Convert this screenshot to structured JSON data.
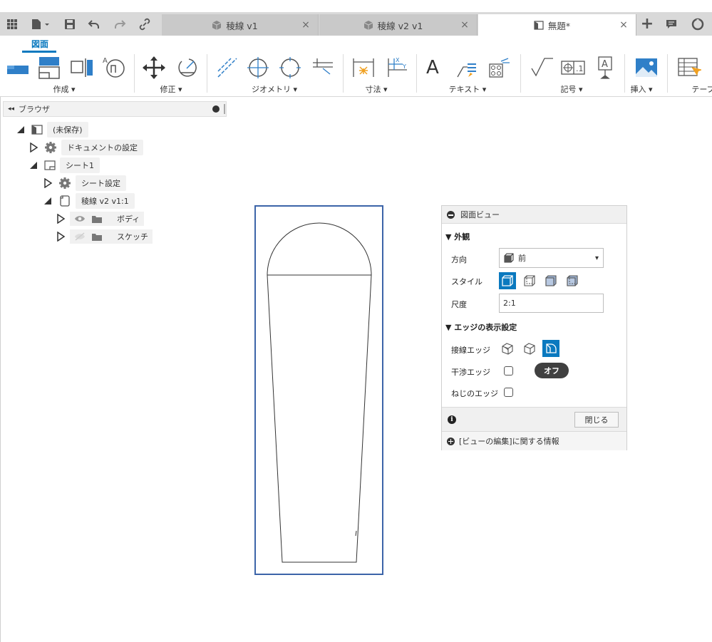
{
  "tabs": [
    {
      "label": "稜線 v1",
      "active": false
    },
    {
      "label": "稜線 v2 v1",
      "active": false
    },
    {
      "label": "無題*",
      "active": true
    }
  ],
  "tab_close": "×",
  "new_tab": "+",
  "ribbon": {
    "active_tab": "図面",
    "groups": [
      "作成 ▾",
      "修正 ▾",
      "ジオメトリ ▾",
      "寸法 ▾",
      "テキスト ▾",
      "記号 ▾",
      "挿入 ▾",
      "テーブル"
    ]
  },
  "text_tool_glyph": "A",
  "browser": {
    "title": "ブラウザ",
    "collapse": "◂◂",
    "items": [
      {
        "label": "(未保存)"
      },
      {
        "label": "ドキュメントの設定"
      },
      {
        "label": "シート1"
      },
      {
        "label": "シート設定"
      },
      {
        "label": "稜線 v2 v1:1"
      },
      {
        "label": "ボディ"
      },
      {
        "label": "スケッチ"
      }
    ]
  },
  "panel": {
    "title": "図面ビュー",
    "appearance_header": "▼ 外観",
    "orientation_label": "方向",
    "orientation_value": "前",
    "style_label": "スタイル",
    "scale_label": "尺度",
    "scale_value": "2:1",
    "edge_header": "▼ エッジの表示設定",
    "tangent_label": "接線エッジ",
    "interference_label": "干渉エッジ",
    "thread_label": "ねじのエッジ",
    "tooltip": "オフ",
    "close_button": "閉じる",
    "info_label": "[ビューの編集]に関する情報",
    "info_icon": "i",
    "dropdown_arrow": "▾"
  },
  "colors": {
    "accent": "#0a79bf",
    "frame": "#3c64a8",
    "tabbar": "#d9d9d9"
  }
}
